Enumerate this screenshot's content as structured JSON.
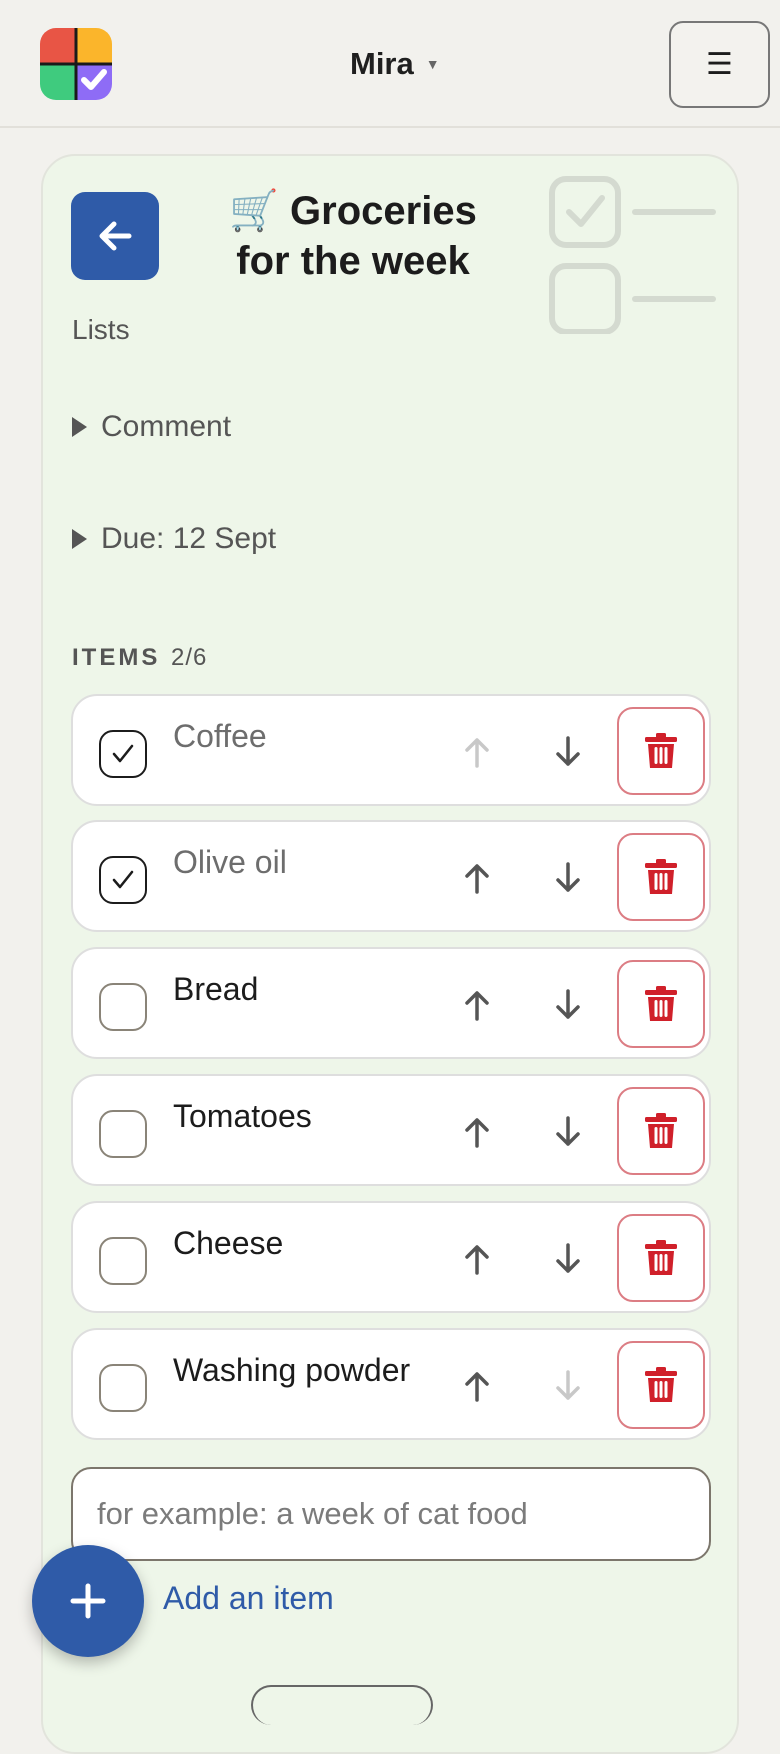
{
  "header": {
    "user_name": "Mira",
    "caret": "▼",
    "menu_icon": "☰",
    "logo_colors": [
      "#e85545",
      "#fbb52b",
      "#3fcb7e",
      "#8e6cf6"
    ]
  },
  "list": {
    "title": "🛒 Groceries for the week",
    "breadcrumb": "Lists",
    "comment_label": "Comment",
    "due_label": "Due: 12 Sept",
    "items_label": "ITEMS",
    "items_count": "2/6",
    "items": [
      {
        "text": "Coffee",
        "checked": true,
        "up_enabled": false,
        "down_enabled": true
      },
      {
        "text": "Olive oil",
        "checked": true,
        "up_enabled": true,
        "down_enabled": true
      },
      {
        "text": "Bread",
        "checked": false,
        "up_enabled": true,
        "down_enabled": true
      },
      {
        "text": "Tomatoes",
        "checked": false,
        "up_enabled": true,
        "down_enabled": true
      },
      {
        "text": "Cheese",
        "checked": false,
        "up_enabled": true,
        "down_enabled": true
      },
      {
        "text": "Washing powder",
        "checked": false,
        "up_enabled": true,
        "down_enabled": false
      }
    ],
    "add_placeholder": "for example: a week of cat food",
    "add_link": "Add an item"
  },
  "colors": {
    "accent": "#2f5ba8",
    "card_bg": "#eef6e9",
    "delete": "#d0202a",
    "arrow": "#555555",
    "arrow_disabled": "#c8c8c8"
  }
}
